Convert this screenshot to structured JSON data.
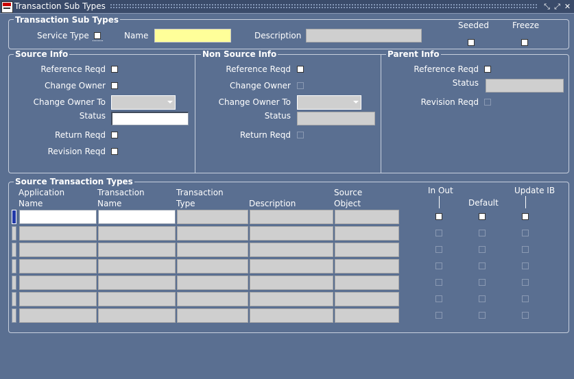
{
  "window": {
    "title": "Transaction Sub Types"
  },
  "header": {
    "section_title": "Transaction Sub Types",
    "service_type_label": "Service Type",
    "name_label": "Name",
    "description_label": "Description",
    "seeded_label": "Seeded",
    "freeze_label": "Freeze"
  },
  "source_info": {
    "title": "Source Info",
    "reference_reqd": "Reference Reqd",
    "change_owner": "Change Owner",
    "change_owner_to": "Change Owner To",
    "status": "Status",
    "return_reqd": "Return Reqd",
    "revision_reqd": "Revision Reqd"
  },
  "non_source_info": {
    "title": "Non Source Info",
    "reference_reqd": "Reference Reqd",
    "change_owner": "Change Owner",
    "change_owner_to": "Change Owner To",
    "status": "Status",
    "return_reqd": "Return Reqd"
  },
  "parent_info": {
    "title": "Parent Info",
    "reference_reqd": "Reference Reqd",
    "status": "Status",
    "revision_reqd": "Revision Reqd"
  },
  "source_txn_types": {
    "title": "Source Transaction Types",
    "columns": {
      "app_name_1": "Application",
      "app_name_2": "Name",
      "txn_name_1": "Transaction",
      "txn_name_2": "Name",
      "txn_type_1": "Transaction",
      "txn_type_2": "Type",
      "description": "Description",
      "source_obj_1": "Source",
      "source_obj_2": "Object",
      "in_out": "In Out",
      "default": "Default",
      "update_ib": "Update IB"
    },
    "row_count": 7
  }
}
